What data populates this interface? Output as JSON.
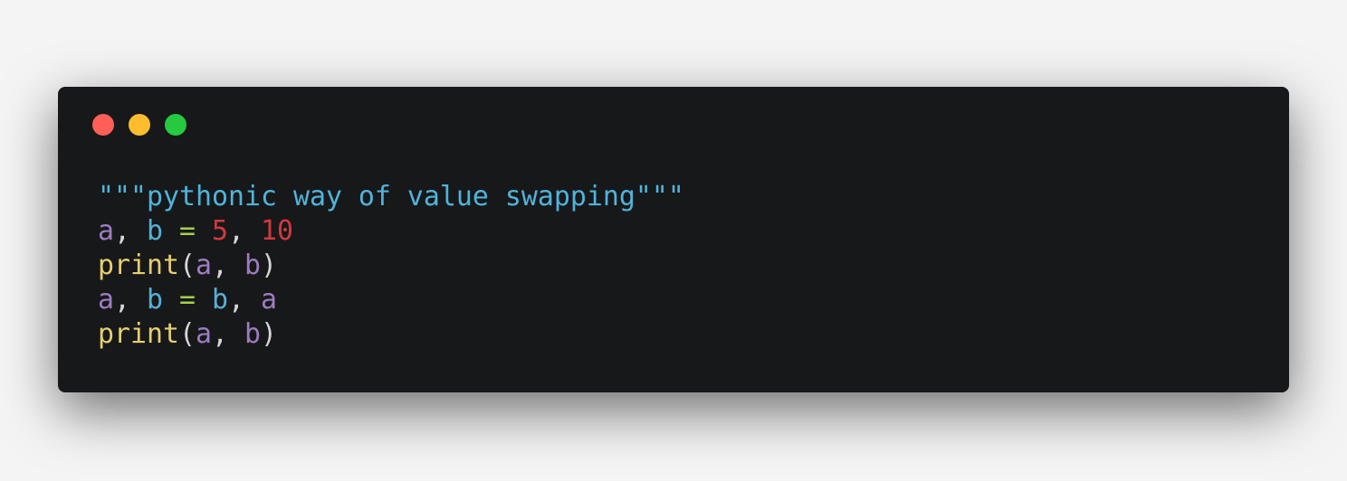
{
  "window_controls": {
    "close": {
      "icon": "close-dot-icon",
      "color": "#ff5f56"
    },
    "minimize": {
      "icon": "minimize-dot-icon",
      "color": "#ffbd2e"
    },
    "maximize": {
      "icon": "maximize-dot-icon",
      "color": "#27c93f"
    }
  },
  "colors": {
    "background": "#17181a",
    "string": "#4fb4da",
    "variable": "#9d7cc0",
    "target": "#57b0d6",
    "operator": "#a6d04a",
    "number": "#d1393f",
    "function": "#e5cf6e",
    "punctuation": "#d6d6d6"
  },
  "code": {
    "language": "python",
    "lines": [
      [
        {
          "t": "\"\"\"pythonic way of value swapping\"\"\"",
          "k": "string"
        }
      ],
      [
        {
          "t": "a",
          "k": "variable"
        },
        {
          "t": ", ",
          "k": "punctuation"
        },
        {
          "t": "b",
          "k": "target"
        },
        {
          "t": " ",
          "k": "punctuation"
        },
        {
          "t": "=",
          "k": "operator"
        },
        {
          "t": " ",
          "k": "punctuation"
        },
        {
          "t": "5",
          "k": "number"
        },
        {
          "t": ", ",
          "k": "punctuation"
        },
        {
          "t": "10",
          "k": "number"
        }
      ],
      [
        {
          "t": "print",
          "k": "function"
        },
        {
          "t": "(",
          "k": "punctuation"
        },
        {
          "t": "a",
          "k": "variable"
        },
        {
          "t": ", ",
          "k": "punctuation"
        },
        {
          "t": "b",
          "k": "variable"
        },
        {
          "t": ")",
          "k": "punctuation"
        }
      ],
      [
        {
          "t": "a",
          "k": "variable"
        },
        {
          "t": ", ",
          "k": "punctuation"
        },
        {
          "t": "b",
          "k": "target"
        },
        {
          "t": " ",
          "k": "punctuation"
        },
        {
          "t": "=",
          "k": "operator"
        },
        {
          "t": " ",
          "k": "punctuation"
        },
        {
          "t": "b",
          "k": "target"
        },
        {
          "t": ", ",
          "k": "punctuation"
        },
        {
          "t": "a",
          "k": "variable"
        }
      ],
      [
        {
          "t": "print",
          "k": "function"
        },
        {
          "t": "(",
          "k": "punctuation"
        },
        {
          "t": "a",
          "k": "variable"
        },
        {
          "t": ", ",
          "k": "punctuation"
        },
        {
          "t": "b",
          "k": "variable"
        },
        {
          "t": ")",
          "k": "punctuation"
        }
      ]
    ]
  }
}
